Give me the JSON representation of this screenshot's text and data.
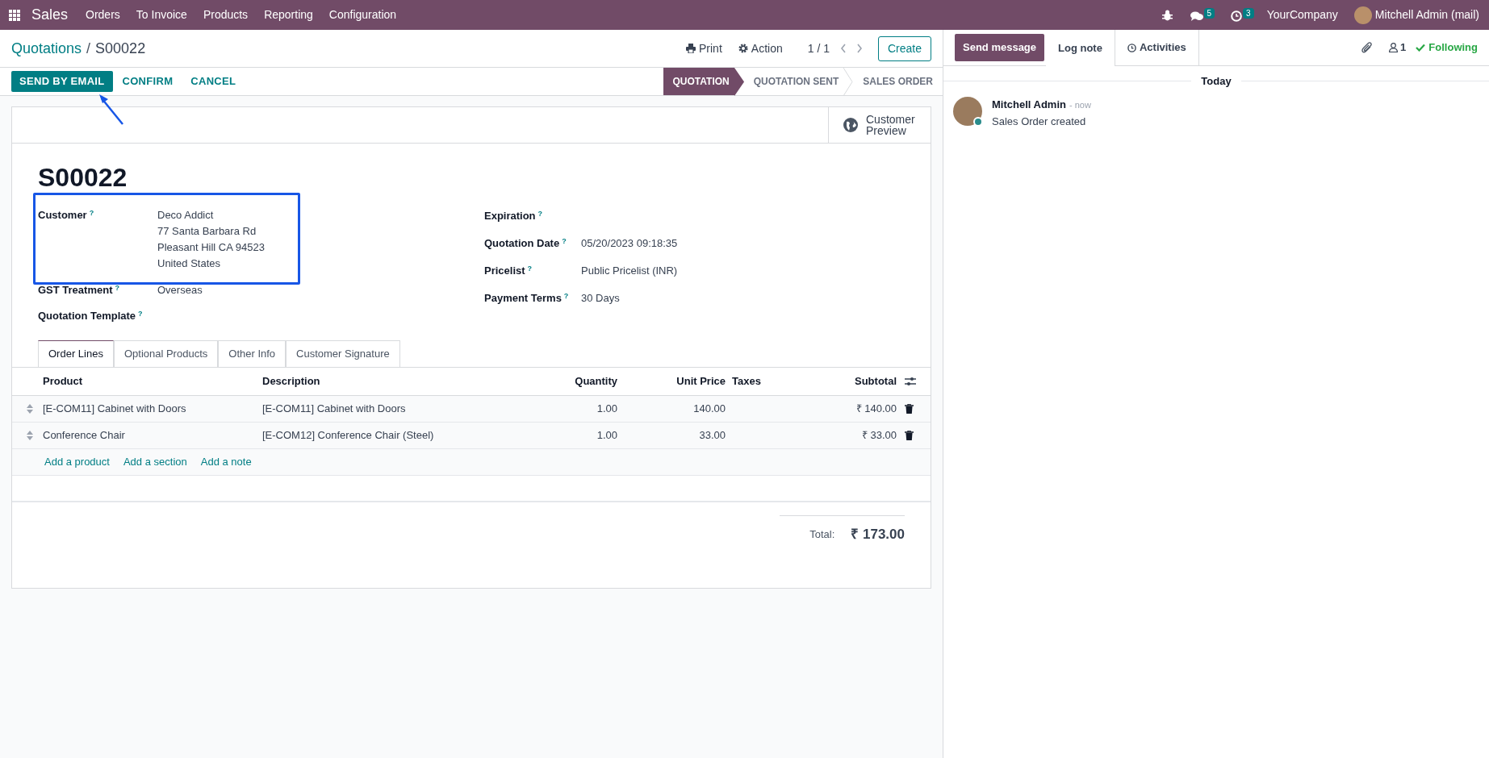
{
  "navbar": {
    "app": "Sales",
    "menu": [
      "Orders",
      "To Invoice",
      "Products",
      "Reporting",
      "Configuration"
    ],
    "messages_count": "5",
    "activities_count": "3",
    "company": "YourCompany",
    "user": "Mitchell Admin (mail)"
  },
  "breadcrumb": {
    "parent": "Quotations",
    "separator": "/",
    "current": "S00022"
  },
  "control": {
    "print": "Print",
    "action": "Action",
    "pager": "1 / 1",
    "create": "Create"
  },
  "header_buttons": [
    {
      "label": "SEND BY EMAIL",
      "kind": "primary"
    },
    {
      "label": "CONFIRM",
      "kind": "link"
    },
    {
      "label": "CANCEL",
      "kind": "link"
    }
  ],
  "status_steps": [
    {
      "label": "QUOTATION",
      "selected": true
    },
    {
      "label": "QUOTATION SENT",
      "selected": false
    },
    {
      "label": "SALES ORDER",
      "selected": false
    }
  ],
  "smart_button": {
    "label": "Customer Preview"
  },
  "title": "S00022",
  "left_fields": [
    {
      "label": "Customer",
      "help": "?",
      "value_lines": [
        "Deco Addict",
        "77 Santa Barbara Rd",
        "Pleasant Hill CA 94523",
        "United States"
      ]
    },
    {
      "label": "GST Treatment",
      "help": "?",
      "value_lines": [
        "Overseas"
      ]
    },
    {
      "label": "Quotation Template",
      "help": "?"
    }
  ],
  "right_fields": [
    {
      "label": "Expiration",
      "help": "?"
    },
    {
      "label": "Quotation Date",
      "help": "?",
      "value": "05/20/2023 09:18:35"
    },
    {
      "label": "Pricelist",
      "help": "?",
      "value": "Public Pricelist (INR)"
    },
    {
      "label": "Payment Terms",
      "help": "?",
      "value": "30 Days"
    }
  ],
  "tabs": [
    {
      "label": "Order Lines",
      "selected": true
    },
    {
      "label": "Optional Products",
      "selected": false
    },
    {
      "label": "Other Info",
      "selected": false
    },
    {
      "label": "Customer Signature",
      "selected": false
    }
  ],
  "table": {
    "columns": [
      "Product",
      "Description",
      "Quantity",
      "Unit Price",
      "Taxes",
      "Subtotal"
    ],
    "rows": [
      [
        "[E-COM11] Cabinet with Doors",
        "[E-COM11] Cabinet with Doors",
        "1.00",
        "140.00",
        "",
        "₹ 140.00"
      ],
      [
        "Conference Chair",
        "[E-COM12] Conference Chair (Steel)",
        "1.00",
        "33.00",
        "",
        "₹ 33.00"
      ]
    ],
    "add_links": [
      "Add a product",
      "Add a section",
      "Add a note"
    ]
  },
  "total": {
    "label": "Total:",
    "value": "₹ 173.00"
  },
  "chatter": {
    "buttons": [
      {
        "label": "Send message",
        "kind": "primary"
      },
      {
        "label": "Log note",
        "kind": "tab"
      },
      {
        "label": "Activities",
        "kind": "activities"
      }
    ],
    "followers": "1",
    "following": "Following",
    "date_separator": "Today",
    "messages": [
      {
        "author": "Mitchell Admin",
        "time": "- now",
        "body": "Sales Order created"
      }
    ]
  }
}
